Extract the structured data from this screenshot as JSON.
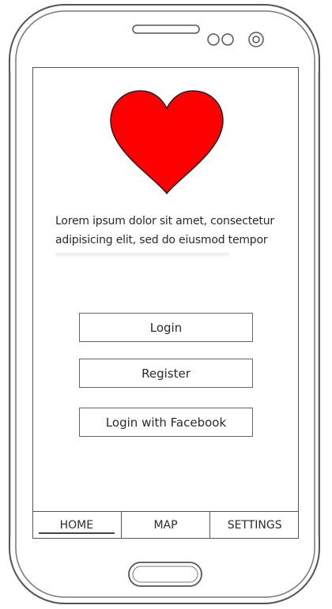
{
  "intro": {
    "text": "Lorem ipsum dolor sit amet, consectetur adipisicing elit, sed do eiusmod tempor"
  },
  "buttons": {
    "login": "Login",
    "register": "Register",
    "facebook": "Login with Facebook"
  },
  "tabs": [
    {
      "label": "HOME",
      "active": true
    },
    {
      "label": "MAP",
      "active": false
    },
    {
      "label": "SETTINGS",
      "active": false
    }
  ],
  "colors": {
    "heart": "#ff0000",
    "outline": "#555555"
  },
  "icons": {
    "heart": "heart-icon",
    "speaker": "speaker-slot-icon",
    "sensors": "sensor-dots-icon",
    "camera": "front-camera-icon",
    "home_button": "home-button-icon"
  }
}
